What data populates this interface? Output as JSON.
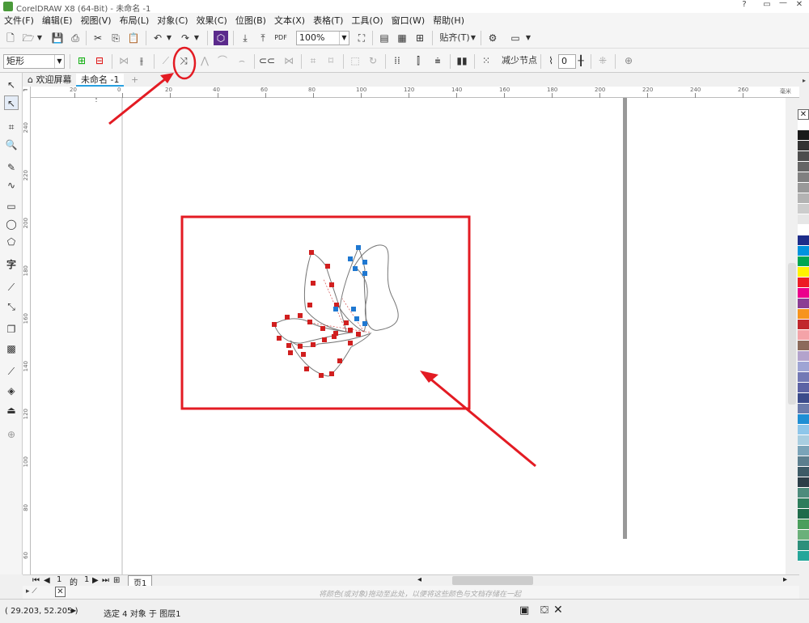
{
  "app": {
    "title": "CorelDRAW X8 (64-Bit) - 未命名 -1",
    "window_buttons": [
      "?",
      "▭",
      "—",
      "✕"
    ]
  },
  "menu": [
    "文件(F)",
    "编辑(E)",
    "视图(V)",
    "布局(L)",
    "对象(C)",
    "效果(C)",
    "位图(B)",
    "文本(X)",
    "表格(T)",
    "工具(O)",
    "窗口(W)",
    "帮助(H)"
  ],
  "toolbar": {
    "zoom": "100%",
    "snap_label": "贴齐(T)",
    "pdf_label": "PDF"
  },
  "propbar": {
    "shape_select": "矩形",
    "reduce_nodes": "减少节点",
    "smooth_value": "0"
  },
  "tabs": {
    "welcome": "欢迎屏幕",
    "doc": "未命名 -1",
    "add": "+"
  },
  "ruler": {
    "h_labels": [
      "20",
      "0",
      "20",
      "40",
      "60",
      "80",
      "100",
      "120",
      "140",
      "160",
      "180",
      "200",
      "220",
      "240",
      "260"
    ],
    "h_unit": "毫米",
    "v_labels": [
      "240",
      "220",
      "200",
      "180",
      "160",
      "140",
      "120",
      "100",
      "80",
      "60"
    ]
  },
  "pagenav": {
    "current": "1",
    "of": "的",
    "total": "1",
    "page_tab": "页1"
  },
  "hint": "将颜色(或对象)拖动至此处，以便将这些颜色与文档存储在一起",
  "status": {
    "coords": "( 29.203, 52.205 )",
    "selection": "选定 4 对象 于 图层1"
  },
  "palette": [
    "#ffffff",
    "#1a1a1a",
    "#333333",
    "#4d4d4d",
    "#666666",
    "#808080",
    "#999999",
    "#b3b3b3",
    "#cccccc",
    "#e6e6e6",
    "#ffffff",
    "#1d2d8a",
    "#0093dd",
    "#00a651",
    "#fff200",
    "#ed1c24",
    "#ec008c",
    "#8b3e94",
    "#f7941d",
    "#c1272d",
    "#f4a3a8",
    "#8c6b5b",
    "#b3a3cc",
    "#9ea4d4",
    "#7379b5",
    "#5d63a5",
    "#3b4b8b",
    "#6b7bab",
    "#1f8fd4",
    "#8ec6ea",
    "#a8cde0",
    "#7aa3b8",
    "#5c7e8e",
    "#3d5a66",
    "#2c3e48",
    "#4d8b7c",
    "#2e7d5c",
    "#1f6b4a",
    "#4a9e5c",
    "#6bb07a",
    "#2d8f7b",
    "#26a69a"
  ],
  "annotation_color": "#e31b23"
}
